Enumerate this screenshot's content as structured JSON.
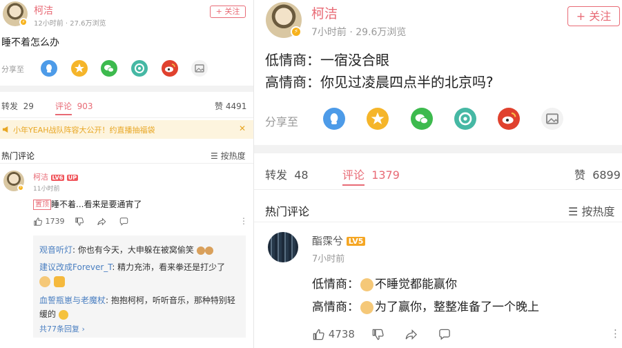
{
  "colors": {
    "accent": "#e86a75",
    "link": "#4a7fc1",
    "banner_bg": "#fdf4de",
    "banner_text": "#e8a623"
  },
  "left": {
    "author": {
      "name": "柯洁",
      "meta": "12小时前 · 27.6万浏览"
    },
    "follow_label": "+ 关注",
    "post_text": "睡不着怎么办",
    "share_label": "分享至",
    "share_icons": [
      "qq-icon",
      "qzone-star-icon",
      "wechat-icon",
      "moments-icon",
      "weibo-icon",
      "image-icon"
    ],
    "tabs": {
      "repost_label": "转发",
      "repost_count": "29",
      "comment_label": "评论",
      "comment_count": "903",
      "like_label": "赞",
      "like_count": "4491"
    },
    "banner": {
      "text": "小年YEAH战队阵容大公开！约直播抽福袋",
      "close": "✕"
    },
    "hot_title": "热门评论",
    "sort_label": "按热度",
    "comment": {
      "user": "柯洁",
      "level": "LV6",
      "up_badge": "UP",
      "time": "11小时前",
      "pinned_label": "置顶",
      "text": "睡不着...看来是要通宵了",
      "like_count": "1739"
    },
    "replies": [
      {
        "user": "观音听灯",
        "text": ": 你也有今天，大申躲在被窝偷笑"
      },
      {
        "user": "建议改成Forever_T",
        "text": ": 精力充沛，看来拳还是打少了"
      },
      {
        "user": "血誓瓶崽与老魔杖",
        "text": ": 抱抱柯柯，听听音乐，那种特别轻缓的"
      }
    ],
    "reply_more": "共77条回复 ›"
  },
  "right": {
    "author": {
      "name": "柯洁",
      "meta": "7小时前 · 29.6万浏览"
    },
    "follow_label": "+ 关注",
    "post_lines": [
      "低情商：一宿没合眼",
      "高情商：你见过凌晨四点半的北京吗?"
    ],
    "share_label": "分享至",
    "tabs": {
      "repost_label": "转发",
      "repost_count": "48",
      "comment_label": "评论",
      "comment_count": "1379",
      "like_label": "赞",
      "like_count": "6899"
    },
    "hot_title": "热门评论",
    "sort_label": "按热度",
    "comment": {
      "user": "酯霂兮",
      "level": "LV5",
      "time": "7小时前",
      "line1_prefix": "低情商：",
      "line1_text": "不睡觉都能赢你",
      "line2_prefix": "高情商：",
      "line2_text": "为了赢你，整整准备了一个晚上",
      "like_count": "4738"
    }
  }
}
